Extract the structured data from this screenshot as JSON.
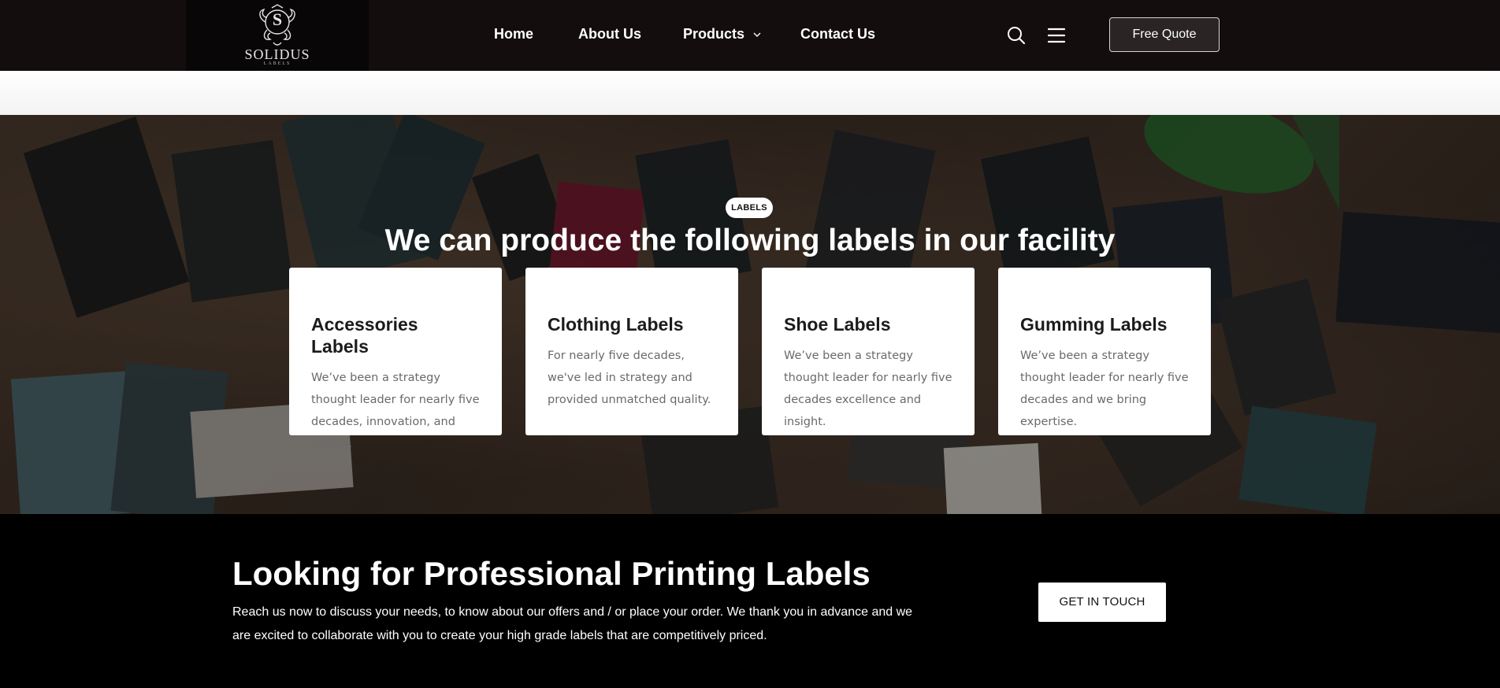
{
  "header": {
    "logo": {
      "brand": "SOLIDUS",
      "sub": "LABELS",
      "monogram": "S"
    },
    "nav": [
      {
        "label": "Home"
      },
      {
        "label": "About Us"
      },
      {
        "label": "Products",
        "has_dropdown": true
      },
      {
        "label": "Contact Us"
      }
    ],
    "icons": [
      "search-icon",
      "menu-icon",
      "chevron-down-icon"
    ],
    "cta_label": "Free Quote"
  },
  "labels_section": {
    "badge": "LABELS",
    "title": "We can produce the following labels in our facility",
    "cards": [
      {
        "title": "Accessories Labels",
        "text": "We’ve been a strategy thought leader for nearly five decades, innovation, and quality."
      },
      {
        "title": "Clothing Labels",
        "text": "For nearly five decades, we've led in strategy and provided unmatched quality."
      },
      {
        "title": "Shoe Labels",
        "text": "We’ve been a strategy thought leader for nearly five decades excellence and insight."
      },
      {
        "title": "Gumming Labels",
        "text": "We’ve been a strategy thought leader for nearly five decades and we bring expertise."
      }
    ]
  },
  "cta": {
    "title": "Looking for Professional Printing Labels",
    "text": "Reach us now to discuss your needs, to know about our offers and / or place your order. We thank you in advance and we are excited to collaborate with you to create your high grade labels that are competitively priced.",
    "button": "GET IN TOUCH"
  },
  "colors": {
    "header_bg": "#130d0d",
    "cta_bg": "#000000",
    "card_bg": "#ffffff",
    "text_light": "#ffffff"
  }
}
